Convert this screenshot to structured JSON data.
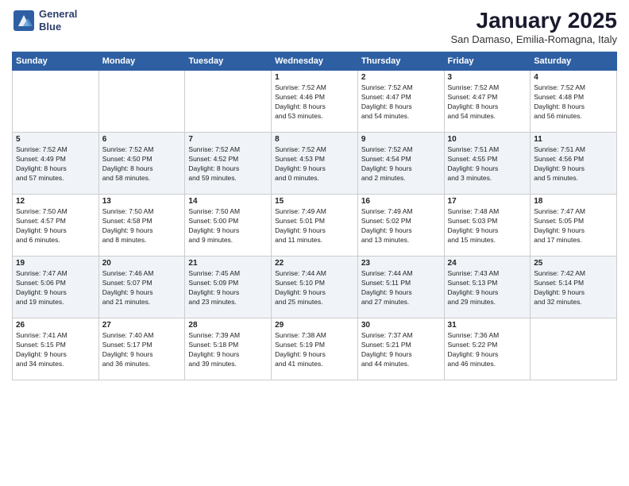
{
  "logo": {
    "line1": "General",
    "line2": "Blue"
  },
  "title": "January 2025",
  "subtitle": "San Damaso, Emilia-Romagna, Italy",
  "days_of_week": [
    "Sunday",
    "Monday",
    "Tuesday",
    "Wednesday",
    "Thursday",
    "Friday",
    "Saturday"
  ],
  "weeks": [
    [
      {
        "day": "",
        "info": ""
      },
      {
        "day": "",
        "info": ""
      },
      {
        "day": "",
        "info": ""
      },
      {
        "day": "1",
        "info": "Sunrise: 7:52 AM\nSunset: 4:46 PM\nDaylight: 8 hours\nand 53 minutes."
      },
      {
        "day": "2",
        "info": "Sunrise: 7:52 AM\nSunset: 4:47 PM\nDaylight: 8 hours\nand 54 minutes."
      },
      {
        "day": "3",
        "info": "Sunrise: 7:52 AM\nSunset: 4:47 PM\nDaylight: 8 hours\nand 54 minutes."
      },
      {
        "day": "4",
        "info": "Sunrise: 7:52 AM\nSunset: 4:48 PM\nDaylight: 8 hours\nand 56 minutes."
      }
    ],
    [
      {
        "day": "5",
        "info": "Sunrise: 7:52 AM\nSunset: 4:49 PM\nDaylight: 8 hours\nand 57 minutes."
      },
      {
        "day": "6",
        "info": "Sunrise: 7:52 AM\nSunset: 4:50 PM\nDaylight: 8 hours\nand 58 minutes."
      },
      {
        "day": "7",
        "info": "Sunrise: 7:52 AM\nSunset: 4:52 PM\nDaylight: 8 hours\nand 59 minutes."
      },
      {
        "day": "8",
        "info": "Sunrise: 7:52 AM\nSunset: 4:53 PM\nDaylight: 9 hours\nand 0 minutes."
      },
      {
        "day": "9",
        "info": "Sunrise: 7:52 AM\nSunset: 4:54 PM\nDaylight: 9 hours\nand 2 minutes."
      },
      {
        "day": "10",
        "info": "Sunrise: 7:51 AM\nSunset: 4:55 PM\nDaylight: 9 hours\nand 3 minutes."
      },
      {
        "day": "11",
        "info": "Sunrise: 7:51 AM\nSunset: 4:56 PM\nDaylight: 9 hours\nand 5 minutes."
      }
    ],
    [
      {
        "day": "12",
        "info": "Sunrise: 7:50 AM\nSunset: 4:57 PM\nDaylight: 9 hours\nand 6 minutes."
      },
      {
        "day": "13",
        "info": "Sunrise: 7:50 AM\nSunset: 4:58 PM\nDaylight: 9 hours\nand 8 minutes."
      },
      {
        "day": "14",
        "info": "Sunrise: 7:50 AM\nSunset: 5:00 PM\nDaylight: 9 hours\nand 9 minutes."
      },
      {
        "day": "15",
        "info": "Sunrise: 7:49 AM\nSunset: 5:01 PM\nDaylight: 9 hours\nand 11 minutes."
      },
      {
        "day": "16",
        "info": "Sunrise: 7:49 AM\nSunset: 5:02 PM\nDaylight: 9 hours\nand 13 minutes."
      },
      {
        "day": "17",
        "info": "Sunrise: 7:48 AM\nSunset: 5:03 PM\nDaylight: 9 hours\nand 15 minutes."
      },
      {
        "day": "18",
        "info": "Sunrise: 7:47 AM\nSunset: 5:05 PM\nDaylight: 9 hours\nand 17 minutes."
      }
    ],
    [
      {
        "day": "19",
        "info": "Sunrise: 7:47 AM\nSunset: 5:06 PM\nDaylight: 9 hours\nand 19 minutes."
      },
      {
        "day": "20",
        "info": "Sunrise: 7:46 AM\nSunset: 5:07 PM\nDaylight: 9 hours\nand 21 minutes."
      },
      {
        "day": "21",
        "info": "Sunrise: 7:45 AM\nSunset: 5:09 PM\nDaylight: 9 hours\nand 23 minutes."
      },
      {
        "day": "22",
        "info": "Sunrise: 7:44 AM\nSunset: 5:10 PM\nDaylight: 9 hours\nand 25 minutes."
      },
      {
        "day": "23",
        "info": "Sunrise: 7:44 AM\nSunset: 5:11 PM\nDaylight: 9 hours\nand 27 minutes."
      },
      {
        "day": "24",
        "info": "Sunrise: 7:43 AM\nSunset: 5:13 PM\nDaylight: 9 hours\nand 29 minutes."
      },
      {
        "day": "25",
        "info": "Sunrise: 7:42 AM\nSunset: 5:14 PM\nDaylight: 9 hours\nand 32 minutes."
      }
    ],
    [
      {
        "day": "26",
        "info": "Sunrise: 7:41 AM\nSunset: 5:15 PM\nDaylight: 9 hours\nand 34 minutes."
      },
      {
        "day": "27",
        "info": "Sunrise: 7:40 AM\nSunset: 5:17 PM\nDaylight: 9 hours\nand 36 minutes."
      },
      {
        "day": "28",
        "info": "Sunrise: 7:39 AM\nSunset: 5:18 PM\nDaylight: 9 hours\nand 39 minutes."
      },
      {
        "day": "29",
        "info": "Sunrise: 7:38 AM\nSunset: 5:19 PM\nDaylight: 9 hours\nand 41 minutes."
      },
      {
        "day": "30",
        "info": "Sunrise: 7:37 AM\nSunset: 5:21 PM\nDaylight: 9 hours\nand 44 minutes."
      },
      {
        "day": "31",
        "info": "Sunrise: 7:36 AM\nSunset: 5:22 PM\nDaylight: 9 hours\nand 46 minutes."
      },
      {
        "day": "",
        "info": ""
      }
    ]
  ]
}
